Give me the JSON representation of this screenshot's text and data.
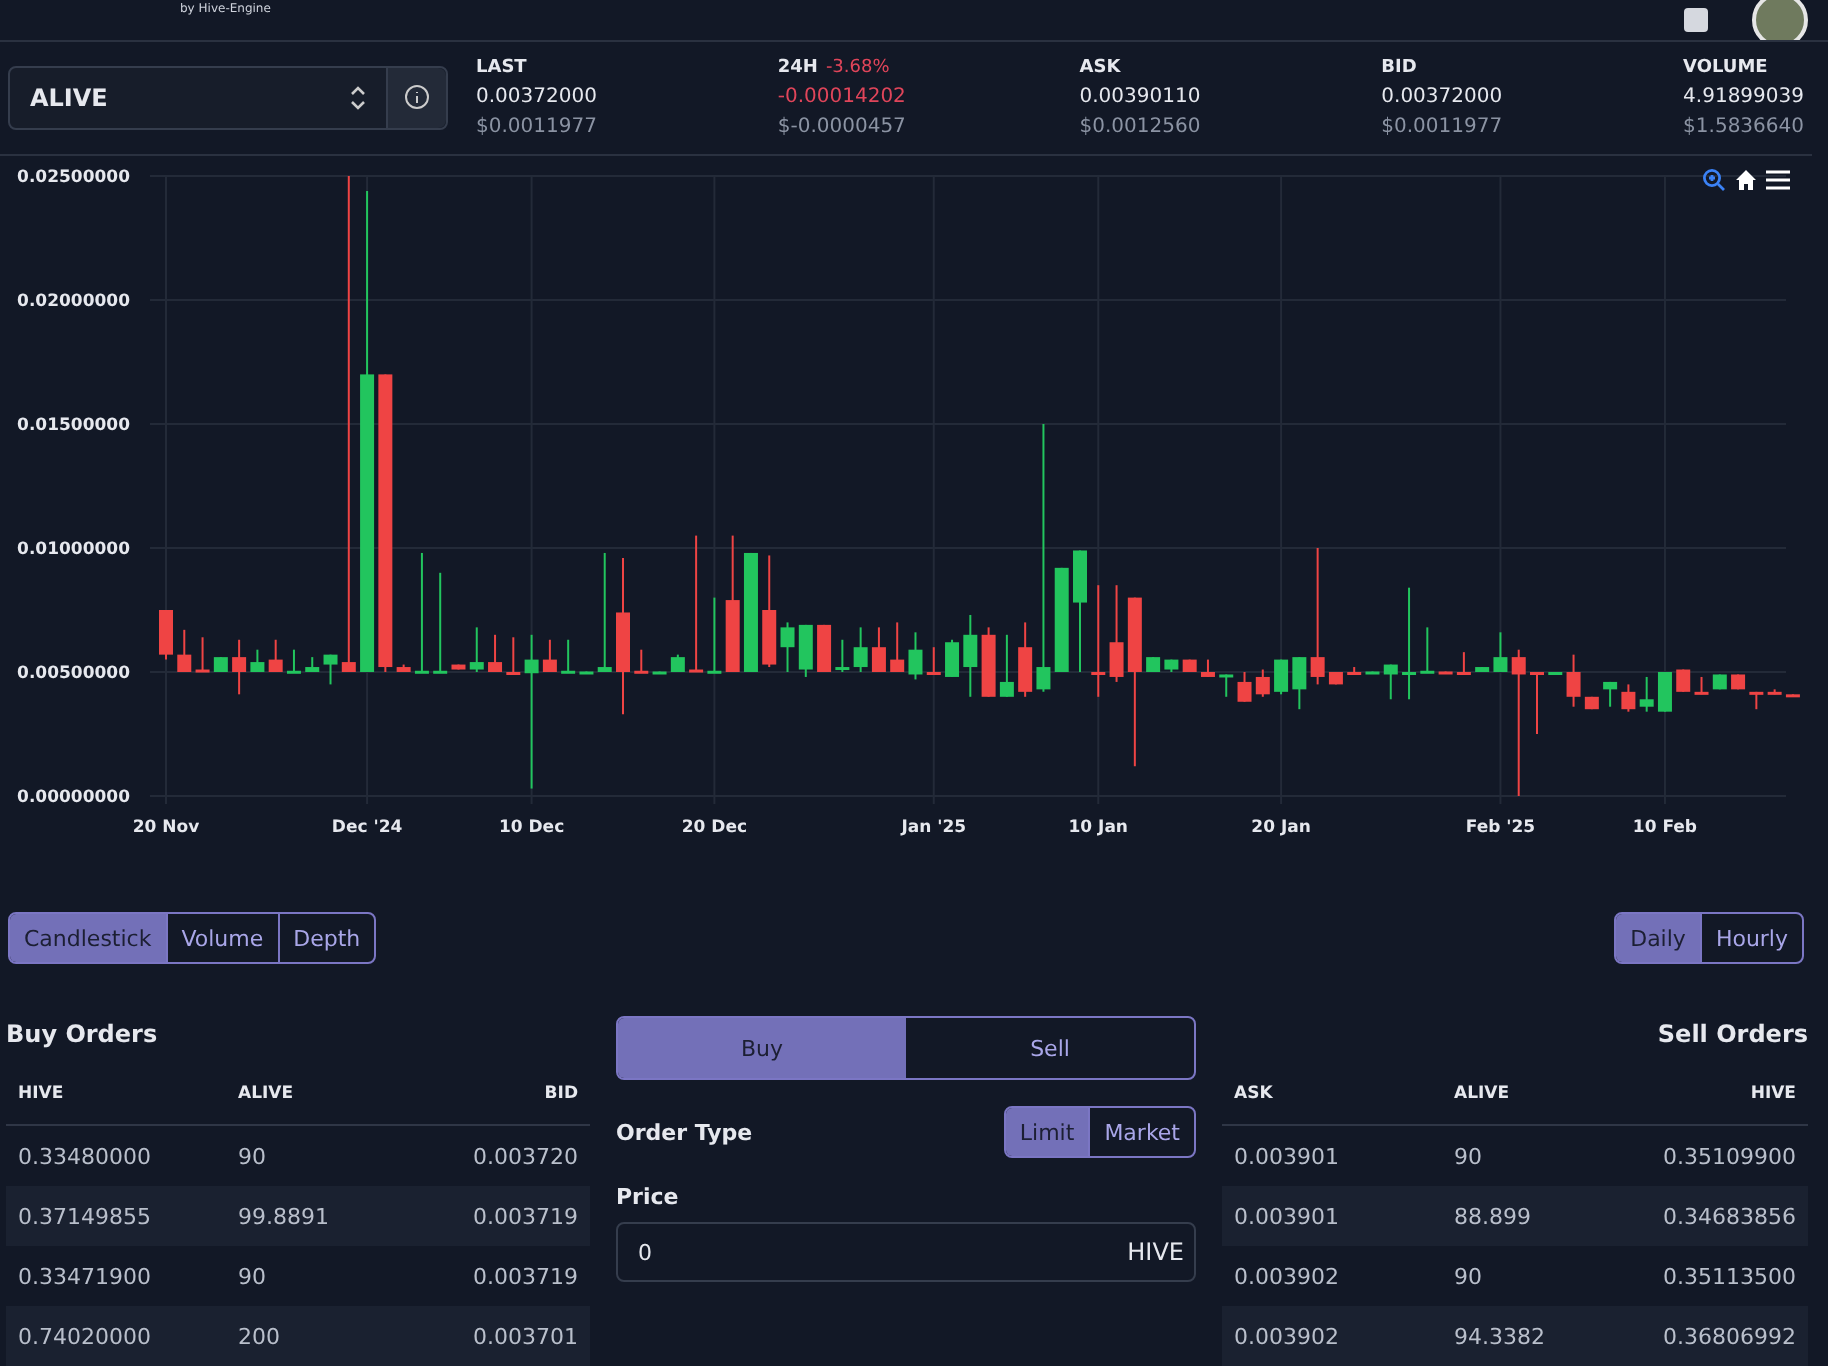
{
  "header": {
    "logo_tagline": "by Hive-Engine"
  },
  "market": {
    "token": "ALIVE",
    "stats": [
      {
        "label": "LAST",
        "value": "0.00372000",
        "usd": "$0.0011977",
        "negative": false
      },
      {
        "label": "24H",
        "change": "-3.68%",
        "value": "-0.00014202",
        "usd": "$-0.0000457",
        "negative": true
      },
      {
        "label": "ASK",
        "value": "0.00390110",
        "usd": "$0.0012560",
        "negative": false
      },
      {
        "label": "BID",
        "value": "0.00372000",
        "usd": "$0.0011977",
        "negative": false
      },
      {
        "label": "VOLUME",
        "value": "4.91899039",
        "usd": "$1.5836640",
        "negative": false
      }
    ]
  },
  "chart": {
    "chart_data": {
      "type": "candlestick",
      "ylim": [
        0,
        0.025
      ],
      "yticks": [
        {
          "value": 0.025,
          "label": "0.02500000"
        },
        {
          "value": 0.02,
          "label": "0.02000000"
        },
        {
          "value": 0.015,
          "label": "0.01500000"
        },
        {
          "value": 0.01,
          "label": "0.01000000"
        },
        {
          "value": 0.005,
          "label": "0.00500000"
        },
        {
          "value": 0,
          "label": "0.00000000"
        }
      ],
      "grid": true,
      "categories": [
        "20 Nov",
        null,
        null,
        null,
        null,
        null,
        null,
        null,
        null,
        null,
        null,
        "Dec '24",
        null,
        null,
        null,
        null,
        null,
        null,
        null,
        null,
        "10 Dec",
        null,
        null,
        null,
        null,
        null,
        null,
        null,
        null,
        null,
        "20 Dec",
        null,
        null,
        null,
        null,
        null,
        null,
        null,
        null,
        null,
        null,
        null,
        "Jan '25",
        null,
        null,
        null,
        null,
        null,
        null,
        null,
        null,
        "10 Jan",
        null,
        null,
        null,
        null,
        null,
        null,
        null,
        null,
        null,
        "20 Jan",
        null,
        null,
        null,
        null,
        null,
        null,
        null,
        null,
        null,
        null,
        null,
        "Feb '25",
        null,
        null,
        null,
        null,
        null,
        null,
        null,
        null,
        "10 Feb",
        null,
        null,
        null,
        null,
        null,
        null,
        null
      ],
      "ohlc": [
        [
          0.0075,
          0.0075,
          0.0055,
          0.0057
        ],
        [
          0.0057,
          0.0067,
          0.005,
          0.005
        ],
        [
          0.0051,
          0.0064,
          0.005,
          0.005
        ],
        [
          0.005,
          0.0056,
          0.005,
          0.0056
        ],
        [
          0.0056,
          0.0063,
          0.0041,
          0.005
        ],
        [
          0.005,
          0.0059,
          0.005,
          0.0054
        ],
        [
          0.0055,
          0.0063,
          0.005,
          0.005
        ],
        [
          0.005,
          0.0059,
          0.005,
          0.00505
        ],
        [
          0.005,
          0.0056,
          0.005,
          0.0052
        ],
        [
          0.0053,
          0.0057,
          0.0045,
          0.0057
        ],
        [
          0.0054,
          0.025,
          0.005,
          0.005
        ],
        [
          0.005,
          0.0244,
          0.005,
          0.017
        ],
        [
          0.017,
          0.017,
          0.005,
          0.0052
        ],
        [
          0.0052,
          0.0053,
          0.005,
          0.005
        ],
        [
          0.005,
          0.0098,
          0.005,
          0.00505
        ],
        [
          0.005,
          0.009,
          0.005,
          0.00505
        ],
        [
          0.0053,
          0.0053,
          0.0051,
          0.0051
        ],
        [
          0.0051,
          0.0068,
          0.005,
          0.0054
        ],
        [
          0.0054,
          0.0065,
          0.005,
          0.005
        ],
        [
          0.005,
          0.0064,
          0.00495,
          0.00495
        ],
        [
          0.00495,
          0.0065,
          0.0003,
          0.0055
        ],
        [
          0.0055,
          0.0063,
          0.005,
          0.005
        ],
        [
          0.005,
          0.0063,
          0.005,
          0.00505
        ],
        [
          0.005,
          0.00502,
          0.005,
          0.00502
        ],
        [
          0.005,
          0.0098,
          0.005,
          0.0052
        ],
        [
          0.0074,
          0.0096,
          0.0033,
          0.005
        ],
        [
          0.00505,
          0.0059,
          0.005,
          0.005
        ],
        [
          0.005,
          0.00502,
          0.005,
          0.00502
        ],
        [
          0.005,
          0.0057,
          0.005,
          0.0056
        ],
        [
          0.0051,
          0.0105,
          0.005,
          0.005
        ],
        [
          0.005,
          0.008,
          0.005,
          0.00505
        ],
        [
          0.0079,
          0.0105,
          0.005,
          0.005
        ],
        [
          0.005,
          0.0098,
          0.005,
          0.0098
        ],
        [
          0.0075,
          0.0097,
          0.0052,
          0.0053
        ],
        [
          0.006,
          0.007,
          0.005,
          0.0068
        ],
        [
          0.0051,
          0.0069,
          0.0048,
          0.0069
        ],
        [
          0.0069,
          0.0069,
          0.005,
          0.005
        ],
        [
          0.0051,
          0.0063,
          0.005,
          0.0052
        ],
        [
          0.0052,
          0.0068,
          0.005,
          0.006
        ],
        [
          0.006,
          0.0068,
          0.005,
          0.005
        ],
        [
          0.0055,
          0.007,
          0.005,
          0.005
        ],
        [
          0.0049,
          0.0066,
          0.0047,
          0.0059
        ],
        [
          0.005,
          0.006,
          0.0049,
          0.00495
        ],
        [
          0.0048,
          0.0063,
          0.0048,
          0.0062
        ],
        [
          0.0052,
          0.0073,
          0.004,
          0.0065
        ],
        [
          0.0065,
          0.0068,
          0.004,
          0.004
        ],
        [
          0.004,
          0.0065,
          0.004,
          0.0046
        ],
        [
          0.006,
          0.007,
          0.004,
          0.0042
        ],
        [
          0.0043,
          0.015,
          0.0042,
          0.0052
        ],
        [
          0.005,
          0.0092,
          0.005,
          0.0092
        ],
        [
          0.0078,
          0.0099,
          0.005,
          0.0099
        ],
        [
          0.005,
          0.0085,
          0.004,
          0.0049
        ],
        [
          0.0062,
          0.0085,
          0.0046,
          0.0048
        ],
        [
          0.008,
          0.008,
          0.0012,
          0.005
        ],
        [
          0.005,
          0.0056,
          0.005,
          0.0056
        ],
        [
          0.0051,
          0.0055,
          0.005,
          0.0055
        ],
        [
          0.0055,
          0.0055,
          0.005,
          0.005
        ],
        [
          0.005,
          0.0055,
          0.0048,
          0.0048
        ],
        [
          0.0048,
          0.0049,
          0.004,
          0.0049
        ],
        [
          0.0046,
          0.005,
          0.0038,
          0.0038
        ],
        [
          0.0048,
          0.0051,
          0.004,
          0.0041
        ],
        [
          0.0042,
          0.0055,
          0.0041,
          0.0055
        ],
        [
          0.0043,
          0.0056,
          0.0035,
          0.0056
        ],
        [
          0.0056,
          0.01,
          0.0045,
          0.0048
        ],
        [
          0.005,
          0.005,
          0.0045,
          0.0045
        ],
        [
          0.005,
          0.0052,
          0.0049,
          0.0049
        ],
        [
          0.005,
          0.00502,
          0.005,
          0.00502
        ],
        [
          0.0049,
          0.0053,
          0.0039,
          0.0053
        ],
        [
          0.0049,
          0.0084,
          0.0039,
          0.005
        ],
        [
          0.005,
          0.0068,
          0.005,
          0.00505
        ],
        [
          0.00502,
          0.00502,
          0.005,
          0.005
        ],
        [
          0.005,
          0.0058,
          0.0049,
          0.0049
        ],
        [
          0.005,
          0.0052,
          0.005,
          0.0052
        ],
        [
          0.005,
          0.0066,
          0.005,
          0.0056
        ],
        [
          0.0056,
          0.0059,
          0,
          0.0049
        ],
        [
          0.005,
          0.005,
          0.0025,
          0.0049
        ],
        [
          0.0049,
          0.005,
          0.0049,
          0.005
        ],
        [
          0.005,
          0.0057,
          0.0036,
          0.004
        ],
        [
          0.004,
          0.004,
          0.0035,
          0.0035
        ],
        [
          0.0043,
          0.0046,
          0.0036,
          0.0046
        ],
        [
          0.0042,
          0.0045,
          0.0034,
          0.0035
        ],
        [
          0.0036,
          0.0048,
          0.0034,
          0.0039
        ],
        [
          0.0034,
          0.005,
          0.0034,
          0.005
        ],
        [
          0.0051,
          0.0051,
          0.0042,
          0.0042
        ],
        [
          0.0042,
          0.0048,
          0.0041,
          0.00415
        ],
        [
          0.0043,
          0.0049,
          0.0043,
          0.0049
        ],
        [
          0.0049,
          0.0049,
          0.0043,
          0.0043
        ],
        [
          0.0042,
          0.0042,
          0.0035,
          0.0041
        ],
        [
          0.0042,
          0.0043,
          0.0041,
          0.00415
        ],
        [
          0.0041,
          0.0041,
          0.004,
          0.004
        ]
      ]
    }
  },
  "chart_types": [
    {
      "label": "Candlestick",
      "selected": true
    },
    {
      "label": "Volume",
      "selected": false
    },
    {
      "label": "Depth",
      "selected": false
    }
  ],
  "intervals": [
    {
      "label": "Daily",
      "selected": true
    },
    {
      "label": "Hourly",
      "selected": false
    }
  ],
  "buy_orders": {
    "title": "Buy Orders",
    "columns": [
      "HIVE",
      "ALIVE",
      "BID"
    ],
    "rows": [
      [
        "0.33480000",
        "90",
        "0.003720"
      ],
      [
        "0.37149855",
        "99.8891",
        "0.003719"
      ],
      [
        "0.33471900",
        "90",
        "0.003719"
      ],
      [
        "0.74020000",
        "200",
        "0.003701"
      ]
    ]
  },
  "trade_form": {
    "sides": [
      {
        "label": "Buy",
        "selected": true
      },
      {
        "label": "Sell",
        "selected": false
      }
    ],
    "order_type_label": "Order Type",
    "order_types": [
      {
        "label": "Limit",
        "selected": true
      },
      {
        "label": "Market",
        "selected": false
      }
    ],
    "price_label": "Price",
    "price_value": "0",
    "price_unit": "HIVE"
  },
  "sell_orders": {
    "title": "Sell Orders",
    "columns": [
      "ASK",
      "ALIVE",
      "HIVE"
    ],
    "rows": [
      [
        "0.003901",
        "90",
        "0.35109900"
      ],
      [
        "0.003901",
        "88.899",
        "0.34683856"
      ],
      [
        "0.003902",
        "90",
        "0.35113500"
      ],
      [
        "0.003902",
        "94.3382",
        "0.36806992"
      ]
    ]
  }
}
